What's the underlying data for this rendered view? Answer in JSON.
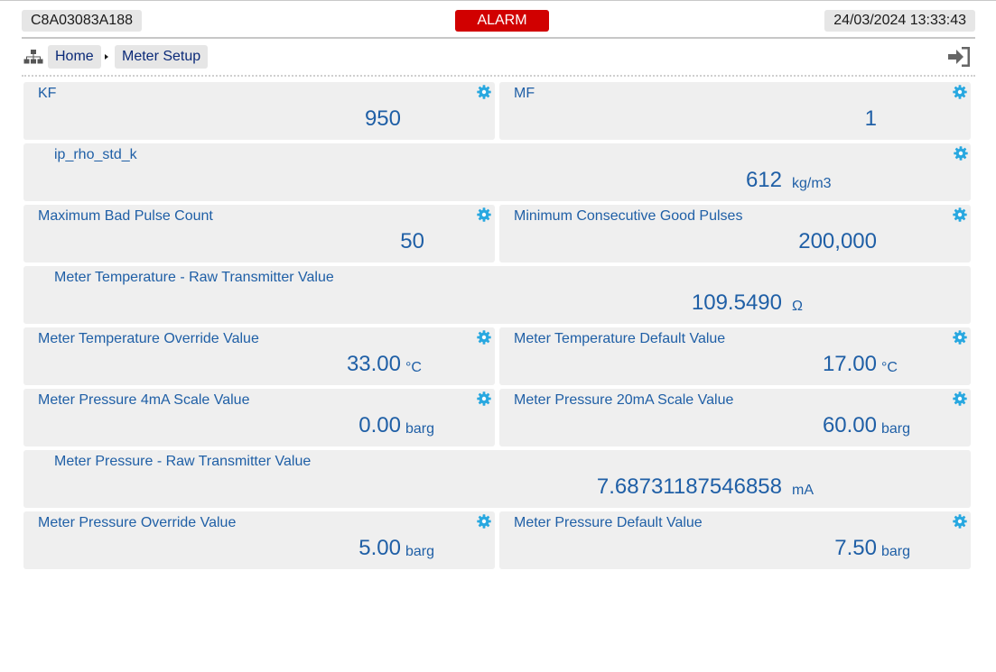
{
  "header": {
    "device_id": "C8A03083A188",
    "alarm_label": "ALARM",
    "datetime": "24/03/2024 13:33:43"
  },
  "breadcrumb": {
    "items": [
      "Home",
      "Meter Setup"
    ]
  },
  "icons": {
    "sitemap": "sitemap-icon",
    "logout": "logout-icon",
    "settings": "gear-icon"
  },
  "colors": {
    "alarm": "#d10000",
    "text": "#1f5fa6",
    "gear": "#29a8e0",
    "card_bg": "#efefef"
  },
  "params": {
    "kf": {
      "label": "KF",
      "value": "950",
      "unit": ""
    },
    "mf": {
      "label": "MF",
      "value": "1",
      "unit": ""
    },
    "ip_rho_std_k": {
      "label": "ip_rho_std_k",
      "value": "612",
      "unit": "kg/m3"
    },
    "max_bad_pulse": {
      "label": "Maximum Bad Pulse Count",
      "value": "50",
      "unit": ""
    },
    "min_good_pulses": {
      "label": "Minimum Consecutive Good Pulses",
      "value": "200,000",
      "unit": ""
    },
    "temp_raw": {
      "label": "Meter Temperature - Raw Transmitter Value",
      "value": "109.5490",
      "unit": "Ω"
    },
    "temp_override": {
      "label": "Meter Temperature Override Value",
      "value": "33.00",
      "unit": "°C"
    },
    "temp_default": {
      "label": "Meter Temperature Default Value",
      "value": "17.00",
      "unit": "°C"
    },
    "press_4ma": {
      "label": "Meter Pressure 4mA Scale Value",
      "value": "0.00",
      "unit": "barg"
    },
    "press_20ma": {
      "label": "Meter Pressure 20mA Scale Value",
      "value": "60.00",
      "unit": "barg"
    },
    "press_raw": {
      "label": "Meter Pressure - Raw Transmitter Value",
      "value": "7.68731187546858",
      "unit": "mA"
    },
    "press_override": {
      "label": "Meter Pressure Override Value",
      "value": "5.00",
      "unit": "barg"
    },
    "press_default": {
      "label": "Meter Pressure Default Value",
      "value": "7.50",
      "unit": "barg"
    }
  }
}
